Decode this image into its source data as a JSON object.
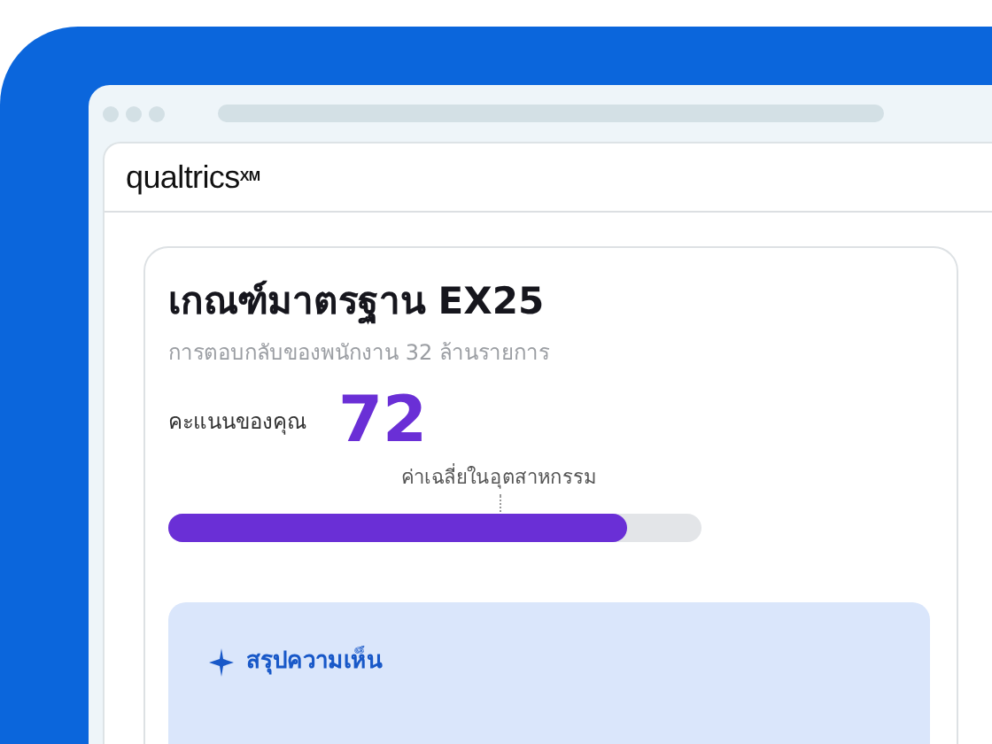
{
  "header": {
    "logo": "qualtrics",
    "logo_mark": "XM"
  },
  "card": {
    "title": "เกณฑ์มาตรฐาน EX25",
    "subtitle": "การตอบกลับของพนักงาน 32 ล้านรายการ",
    "score_label": "คะแนนของคุณ",
    "score": "72",
    "score_bar": {
      "level": 0.86
    },
    "industry_average": {
      "label": "ค่าเฉลี่ยในอุตสาหกรรม"
    }
  },
  "summary": {
    "title": "สรุปความเห็น"
  }
}
